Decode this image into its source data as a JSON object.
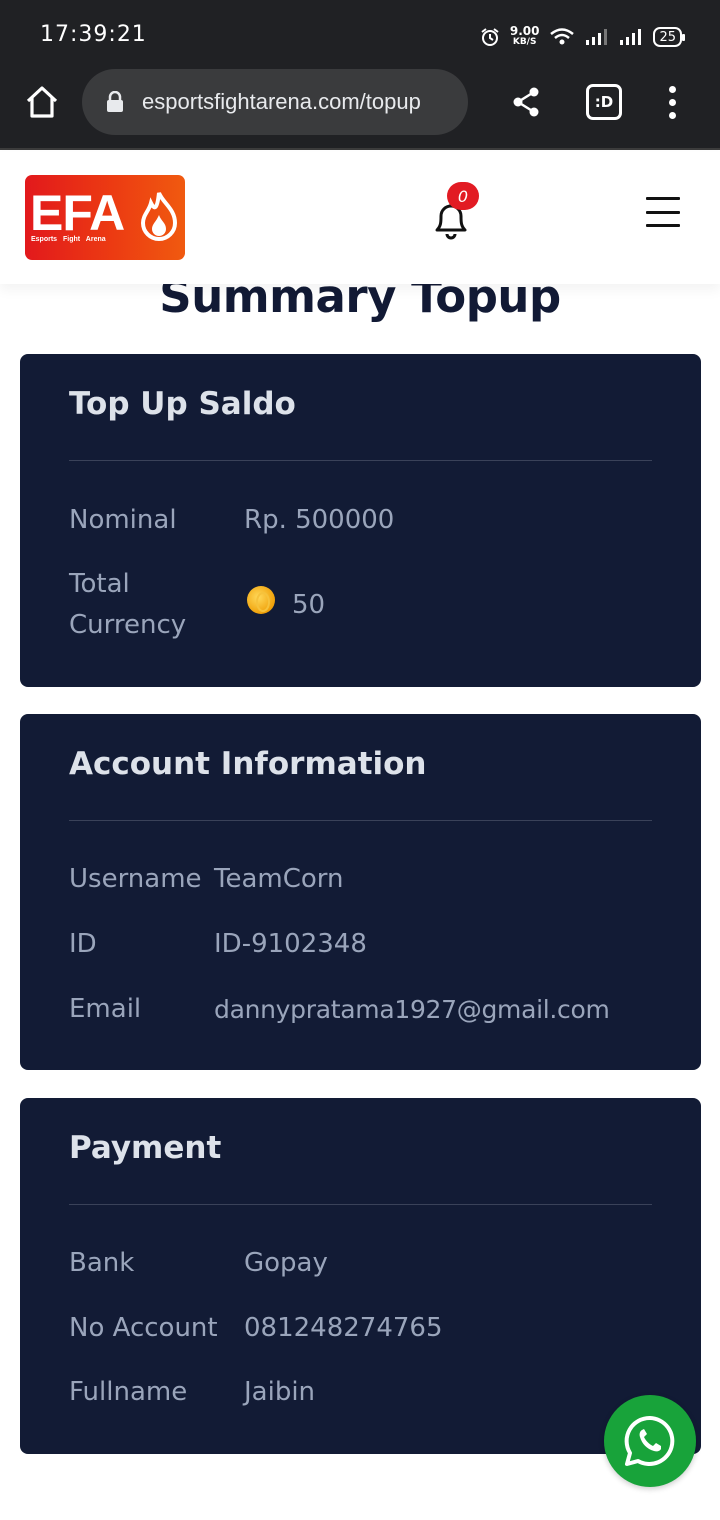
{
  "status_bar": {
    "time": "17:39:21",
    "net_speed": "9.00",
    "net_unit": "KB/S",
    "battery": "25"
  },
  "browser": {
    "url": "esportsfightarena.com/topup",
    "tab_switcher_label": ":D"
  },
  "header": {
    "logo_text": "EFA",
    "logo_subtext": "Esports Fight Arena",
    "notification_count": "0"
  },
  "page": {
    "title": "Summary Topup"
  },
  "topup_card": {
    "title": "Top Up Saldo",
    "nominal_label": "Nominal",
    "nominal_value": "Rp. 500000",
    "currency_label_line1": "Total",
    "currency_label_line2": "Currency",
    "currency_value": "50"
  },
  "account_card": {
    "title": "Account Information",
    "username_label": "Username",
    "username_value": "TeamCorn",
    "id_label": "ID",
    "id_value": "ID-9102348",
    "email_label": "Email",
    "email_value": "dannypratama1927@gmail.com"
  },
  "payment_card": {
    "title": "Payment",
    "bank_label": "Bank",
    "bank_value": "Gopay",
    "account_label": "No Account",
    "account_value": "081248274765",
    "fullname_label": "Fullname",
    "fullname_value": "Jaibin"
  },
  "icons": {
    "home": "home-icon",
    "lock": "lock-icon",
    "share": "share-icon",
    "more": "more-vert-icon",
    "bell": "bell-icon",
    "menu": "hamburger-icon",
    "coin": "coin-icon",
    "whatsapp": "whatsapp-icon"
  },
  "colors": {
    "card_bg": "#121b35",
    "title_color": "#121a35",
    "brand_red": "#e2191c",
    "whatsapp_green": "#18a33a"
  }
}
